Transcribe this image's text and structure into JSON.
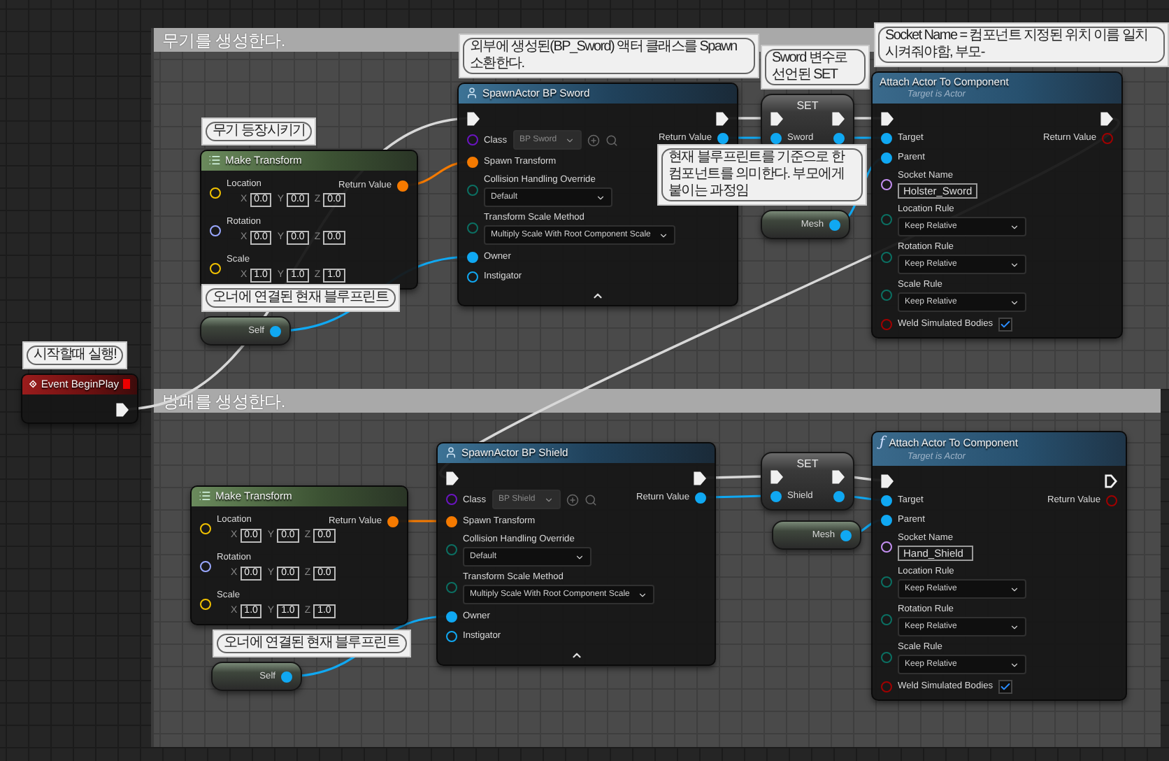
{
  "event": {
    "kind": "event",
    "title": "Event BeginPlay",
    "note": "시작할때 실행!",
    "outputs": [
      {
        "kind": "exec",
        "connected": true
      }
    ]
  },
  "comments": [
    {
      "title": "무기를 생성한다.",
      "nodes": [
        {
          "kind": "make_transform",
          "title": "Make Transform",
          "note": "무기 등장시키기",
          "inputs": [
            {
              "kind": "vector",
              "label": "Location",
              "connected": false,
              "axes": [
                {
                  "axis": "X",
                  "value": "0.0"
                },
                {
                  "axis": "Y",
                  "value": "0.0"
                },
                {
                  "axis": "Z",
                  "value": "0.0"
                }
              ]
            },
            {
              "kind": "rotator",
              "label": "Rotation",
              "connected": false,
              "axes": [
                {
                  "axis": "X",
                  "value": "0.0"
                },
                {
                  "axis": "Y",
                  "value": "0.0"
                },
                {
                  "axis": "Z",
                  "value": "0.0"
                }
              ]
            },
            {
              "kind": "vector",
              "label": "Scale",
              "connected": false,
              "axes": [
                {
                  "axis": "X",
                  "value": "1.0"
                },
                {
                  "axis": "Y",
                  "value": "1.0"
                },
                {
                  "axis": "Z",
                  "value": "1.0"
                }
              ]
            }
          ],
          "outputs": [
            {
              "kind": "struct",
              "label": "Return Value",
              "connected": true
            }
          ]
        },
        {
          "kind": "getter",
          "note": "오너에 연결된 현재 블루프린트",
          "outputs": [
            {
              "kind": "object",
              "label": "Self",
              "connected": true
            }
          ]
        },
        {
          "kind": "spawn",
          "title": "SpawnActor BP Sword",
          "note": "외부에 생성된(BP_Sword) 액터 클래스를 Spawn 소환한다.",
          "inputs": [
            {
              "kind": "exec",
              "connected": true
            },
            {
              "kind": "class",
              "label": "Class",
              "value": "BP Sword",
              "connected": false
            },
            {
              "kind": "struct",
              "label": "Spawn Transform",
              "connected": true
            },
            {
              "kind": "enum",
              "label": "Collision Handling Override",
              "value": "Default",
              "connected": false
            },
            {
              "kind": "enum",
              "label": "Transform Scale Method",
              "value": "Multiply Scale With Root Component Scale",
              "connected": false
            },
            {
              "kind": "object",
              "label": "Owner",
              "connected": true
            },
            {
              "kind": "object",
              "label": "Instigator",
              "connected": false
            }
          ],
          "outputs": [
            {
              "kind": "exec",
              "connected": true
            },
            {
              "kind": "object",
              "label": "Return Value",
              "connected": true
            }
          ]
        },
        {
          "kind": "set",
          "title": "SET",
          "note": "Sword 변수로 선언된 SET",
          "inputs": [
            {
              "kind": "exec",
              "connected": true
            },
            {
              "kind": "object",
              "label": "Sword",
              "connected": true
            }
          ],
          "outputs": [
            {
              "kind": "exec",
              "connected": true
            },
            {
              "kind": "object",
              "connected": true
            }
          ]
        },
        {
          "kind": "getter",
          "note": "현재 블루프린트를 기준으로 한 컴포넌트를 의미한다. 부모에게 붙이는 과정임",
          "outputs": [
            {
              "kind": "object",
              "label": "Mesh",
              "connected": true
            }
          ]
        },
        {
          "kind": "function",
          "title": "Attach Actor To Component",
          "subtitle": "Target is Actor",
          "note": "Socket Name = 컴포넌트 지정된 위치 이름 일치시켜줘야함, 부모-",
          "inputs": [
            {
              "kind": "exec",
              "connected": true
            },
            {
              "kind": "object",
              "label": "Target",
              "connected": true
            },
            {
              "kind": "object",
              "label": "Parent",
              "connected": true
            },
            {
              "kind": "name",
              "label": "Socket Name",
              "value": "Holster_Sword",
              "connected": false
            },
            {
              "kind": "enum",
              "label": "Location Rule",
              "value": "Keep Relative",
              "connected": false
            },
            {
              "kind": "enum",
              "label": "Rotation Rule",
              "value": "Keep Relative",
              "connected": false
            },
            {
              "kind": "enum",
              "label": "Scale Rule",
              "value": "Keep Relative",
              "connected": false
            },
            {
              "kind": "bool",
              "label": "Weld Simulated Bodies",
              "checked": true,
              "connected": false
            }
          ],
          "outputs": [
            {
              "kind": "exec",
              "connected": true
            },
            {
              "kind": "bool",
              "label": "Return Value",
              "connected": false
            }
          ]
        }
      ]
    },
    {
      "title": "방패를 생성한다.",
      "nodes": [
        {
          "kind": "make_transform",
          "title": "Make Transform",
          "inputs": [
            {
              "kind": "vector",
              "label": "Location",
              "connected": false,
              "axes": [
                {
                  "axis": "X",
                  "value": "0.0"
                },
                {
                  "axis": "Y",
                  "value": "0.0"
                },
                {
                  "axis": "Z",
                  "value": "0.0"
                }
              ]
            },
            {
              "kind": "rotator",
              "label": "Rotation",
              "connected": false,
              "axes": [
                {
                  "axis": "X",
                  "value": "0.0"
                },
                {
                  "axis": "Y",
                  "value": "0.0"
                },
                {
                  "axis": "Z",
                  "value": "0.0"
                }
              ]
            },
            {
              "kind": "vector",
              "label": "Scale",
              "connected": false,
              "axes": [
                {
                  "axis": "X",
                  "value": "1.0"
                },
                {
                  "axis": "Y",
                  "value": "1.0"
                },
                {
                  "axis": "Z",
                  "value": "1.0"
                }
              ]
            }
          ],
          "outputs": [
            {
              "kind": "struct",
              "label": "Return Value",
              "connected": true
            }
          ]
        },
        {
          "kind": "getter",
          "note": "오너에 연결된 현재 블루프린트",
          "outputs": [
            {
              "kind": "object",
              "label": "Self",
              "connected": true
            }
          ]
        },
        {
          "kind": "spawn",
          "title": "SpawnActor BP Shield",
          "inputs": [
            {
              "kind": "exec",
              "connected": true
            },
            {
              "kind": "class",
              "label": "Class",
              "value": "BP Shield",
              "connected": false
            },
            {
              "kind": "struct",
              "label": "Spawn Transform",
              "connected": true
            },
            {
              "kind": "enum",
              "label": "Collision Handling Override",
              "value": "Default",
              "connected": false
            },
            {
              "kind": "enum",
              "label": "Transform Scale Method",
              "value": "Multiply Scale With Root Component Scale",
              "connected": false
            },
            {
              "kind": "object",
              "label": "Owner",
              "connected": true
            },
            {
              "kind": "object",
              "label": "Instigator",
              "connected": false
            }
          ],
          "outputs": [
            {
              "kind": "exec",
              "connected": true
            },
            {
              "kind": "object",
              "label": "Return Value",
              "connected": true
            }
          ]
        },
        {
          "kind": "set",
          "title": "SET",
          "inputs": [
            {
              "kind": "exec",
              "connected": true
            },
            {
              "kind": "object",
              "label": "Shield",
              "connected": true
            }
          ],
          "outputs": [
            {
              "kind": "exec",
              "connected": true
            },
            {
              "kind": "object",
              "connected": true
            }
          ]
        },
        {
          "kind": "getter",
          "outputs": [
            {
              "kind": "object",
              "label": "Mesh",
              "connected": true
            }
          ]
        },
        {
          "kind": "function",
          "title": "Attach Actor To Component",
          "subtitle": "Target is Actor",
          "glyph": "ƒ",
          "inputs": [
            {
              "kind": "exec",
              "connected": true
            },
            {
              "kind": "object",
              "label": "Target",
              "connected": true
            },
            {
              "kind": "object",
              "label": "Parent",
              "connected": true
            },
            {
              "kind": "name",
              "label": "Socket Name",
              "value": "Hand_Shield",
              "connected": false
            },
            {
              "kind": "enum",
              "label": "Location Rule",
              "value": "Keep Relative",
              "connected": false
            },
            {
              "kind": "enum",
              "label": "Rotation Rule",
              "value": "Keep Relative",
              "connected": false
            },
            {
              "kind": "enum",
              "label": "Scale Rule",
              "value": "Keep Relative",
              "connected": false
            },
            {
              "kind": "bool",
              "label": "Weld Simulated Bodies",
              "checked": true,
              "connected": false
            }
          ],
          "outputs": [
            {
              "kind": "exec",
              "connected": false
            },
            {
              "kind": "bool",
              "label": "Return Value",
              "connected": false
            }
          ]
        }
      ]
    }
  ]
}
